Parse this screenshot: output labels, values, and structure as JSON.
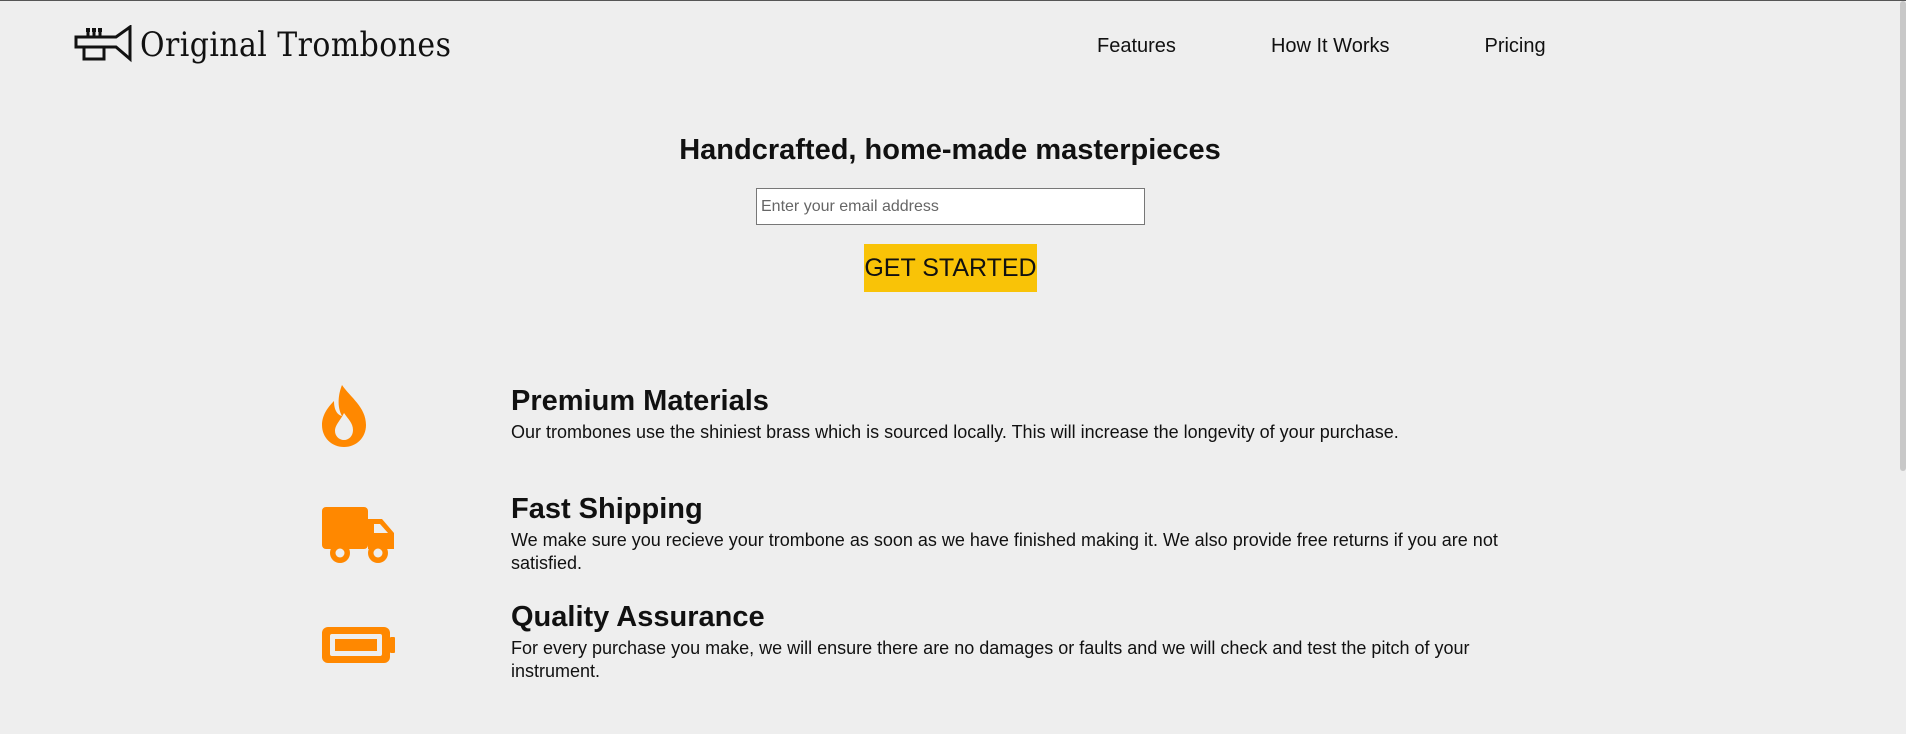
{
  "brand": {
    "name": "Original Trombones",
    "logo_icon": "trumpet-icon"
  },
  "nav": {
    "items": [
      "Features",
      "How It Works",
      "Pricing"
    ]
  },
  "hero": {
    "title": "Handcrafted, home-made masterpieces",
    "email_placeholder": "Enter your email address",
    "cta_label": "GET STARTED"
  },
  "features": [
    {
      "icon": "fire-icon",
      "title": "Premium Materials",
      "description": "Our trombones use the shiniest brass which is sourced locally. This will increase the longevity of your purchase."
    },
    {
      "icon": "truck-icon",
      "title": "Fast Shipping",
      "description": "We make sure you recieve your trombone as soon as we have finished making it. We also provide free returns if you are not satisfied."
    },
    {
      "icon": "battery-icon",
      "title": "Quality Assurance",
      "description": "For every purchase you make, we will ensure there are no damages or faults and we will check and test the pitch of your instrument."
    }
  ],
  "colors": {
    "accent_orange": "#ff8800",
    "cta_yellow": "#f9c307",
    "background": "#eeeeee"
  }
}
